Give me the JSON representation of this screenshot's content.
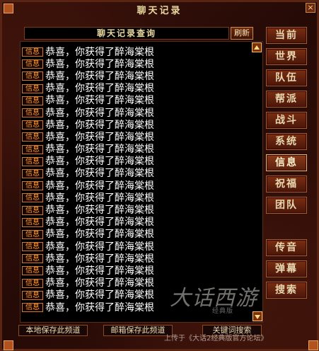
{
  "window": {
    "title": "聊天记录",
    "close": "×"
  },
  "query": {
    "title": "聊天记录查询",
    "refresh_label": "刷新"
  },
  "chat": {
    "messages": [
      {
        "tag": "信息",
        "text": "恭喜，你获得了醉海棠根"
      },
      {
        "tag": "信息",
        "text": "恭喜，你获得了醉海棠根"
      },
      {
        "tag": "信息",
        "text": "恭喜，你获得了醉海棠根"
      },
      {
        "tag": "信息",
        "text": "恭喜，你获得了醉海棠根"
      },
      {
        "tag": "信息",
        "text": "恭喜，你获得了醉海棠根"
      },
      {
        "tag": "信息",
        "text": "恭喜，你获得了醉海棠根"
      },
      {
        "tag": "信息",
        "text": "恭喜，你获得了醉海棠根"
      },
      {
        "tag": "信息",
        "text": "恭喜，你获得了醉海棠根"
      },
      {
        "tag": "信息",
        "text": "恭喜，你获得了醉海棠根"
      },
      {
        "tag": "信息",
        "text": "恭喜，你获得了醉海棠根"
      },
      {
        "tag": "信息",
        "text": "恭喜，你获得了醉海棠根"
      },
      {
        "tag": "信息",
        "text": "恭喜，你获得了醉海棠根"
      },
      {
        "tag": "信息",
        "text": "恭喜，你获得了醉海棠根"
      },
      {
        "tag": "信息",
        "text": "恭喜，你获得了醉海棠根"
      },
      {
        "tag": "信息",
        "text": "恭喜，你获得了醉海棠根"
      },
      {
        "tag": "信息",
        "text": "恭喜，你获得了醉海棠根"
      },
      {
        "tag": "信息",
        "text": "恭喜，你获得了醉海棠根"
      },
      {
        "tag": "信息",
        "text": "恭喜，你获得了醉海棠根"
      },
      {
        "tag": "信息",
        "text": "恭喜，你获得了醉海棠根"
      },
      {
        "tag": "信息",
        "text": "恭喜，你获得了醉海棠根"
      },
      {
        "tag": "信息",
        "text": "恭喜，你获得了醉海棠根"
      },
      {
        "tag": "信息",
        "text": "恭喜，你获得了醉海棠根"
      }
    ]
  },
  "channels": {
    "current": "当前",
    "world": "世界",
    "team": "队伍",
    "guild": "帮派",
    "battle": "战斗",
    "system": "系统",
    "info": "信息",
    "blessing": "祝福",
    "group": "团队",
    "whisper": "传音",
    "barrage": "弹幕",
    "search": "搜索"
  },
  "footer": {
    "save_local": "本地保存此频道",
    "save_mail": "邮箱保存此频道",
    "keyword_search": "关键词搜索"
  },
  "watermark": {
    "logo": "大话西游",
    "sub": "经典版",
    "footer": "上传于《大话2经典版官方论坛》"
  }
}
